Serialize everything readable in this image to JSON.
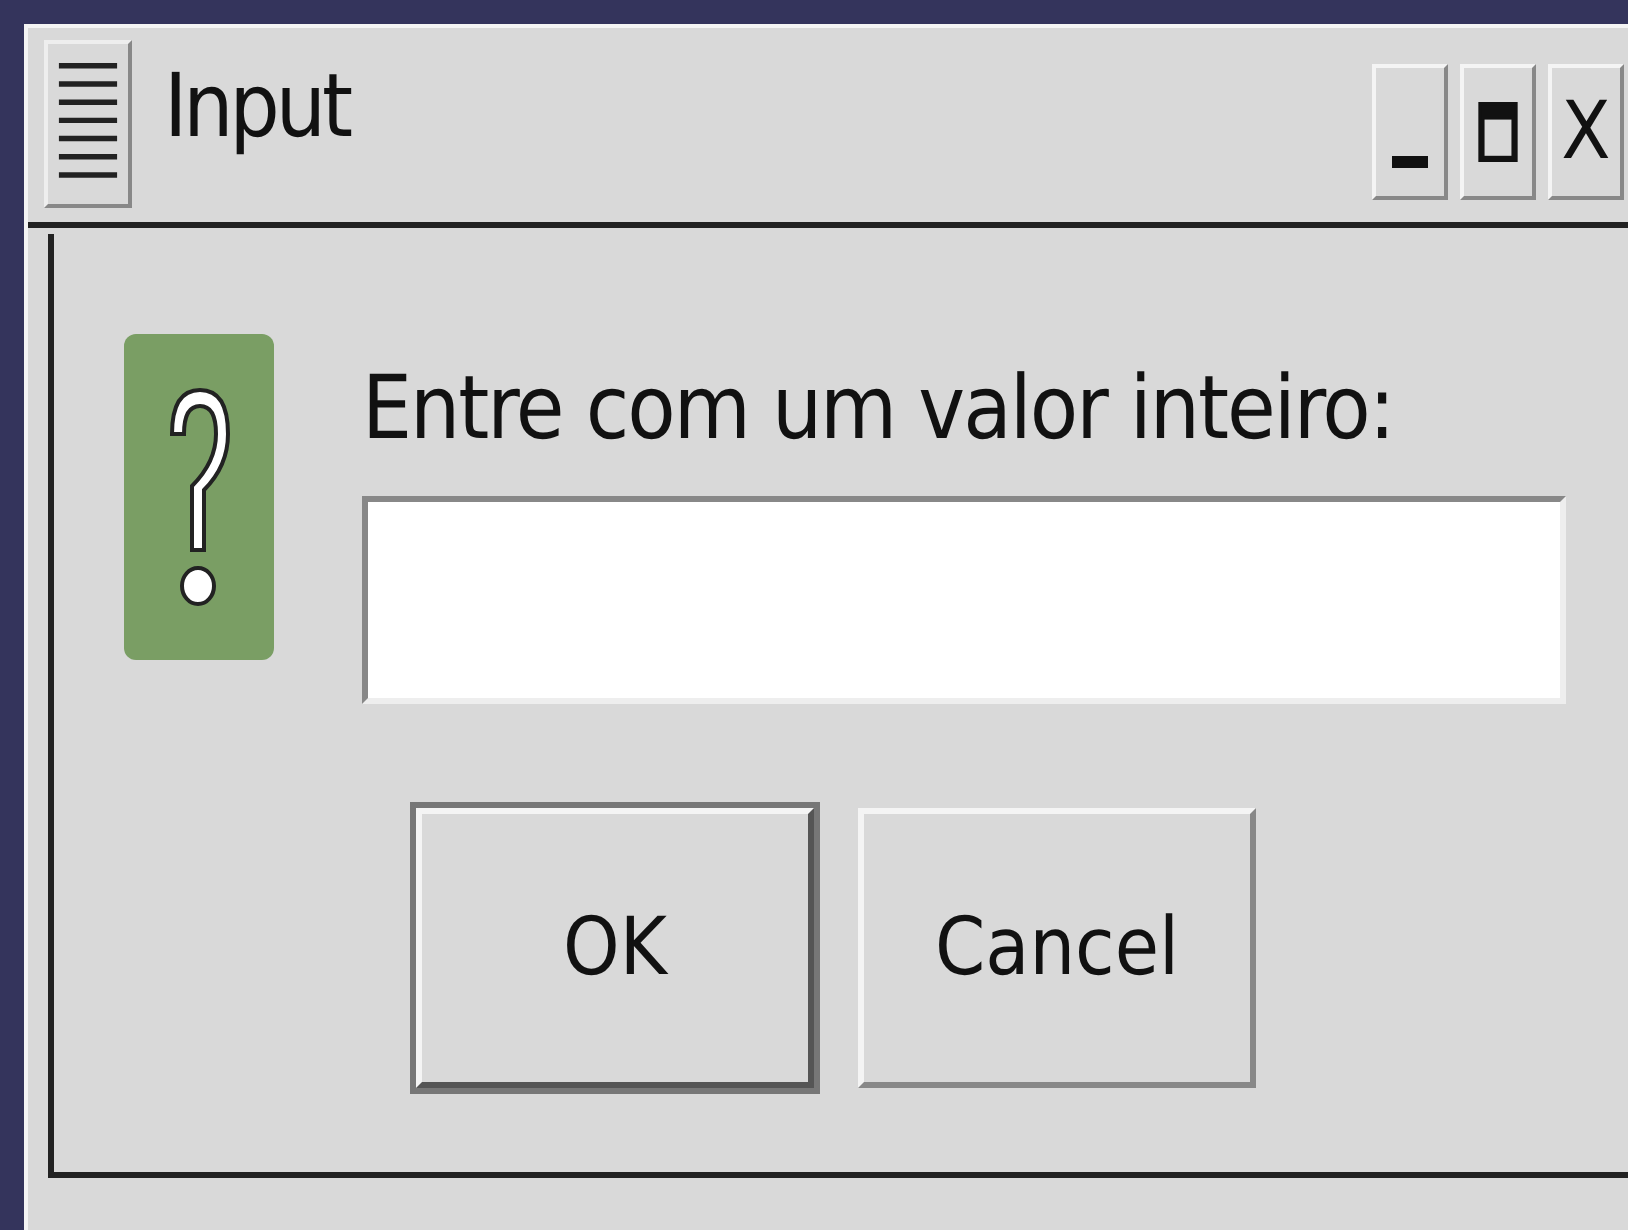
{
  "window": {
    "title": "Input",
    "close_label": "X"
  },
  "dialog": {
    "message": "Entre com um valor inteiro:",
    "buttons": [
      {
        "label": "OK",
        "default": true
      },
      {
        "label": "Cancel",
        "default": false
      }
    ]
  }
}
